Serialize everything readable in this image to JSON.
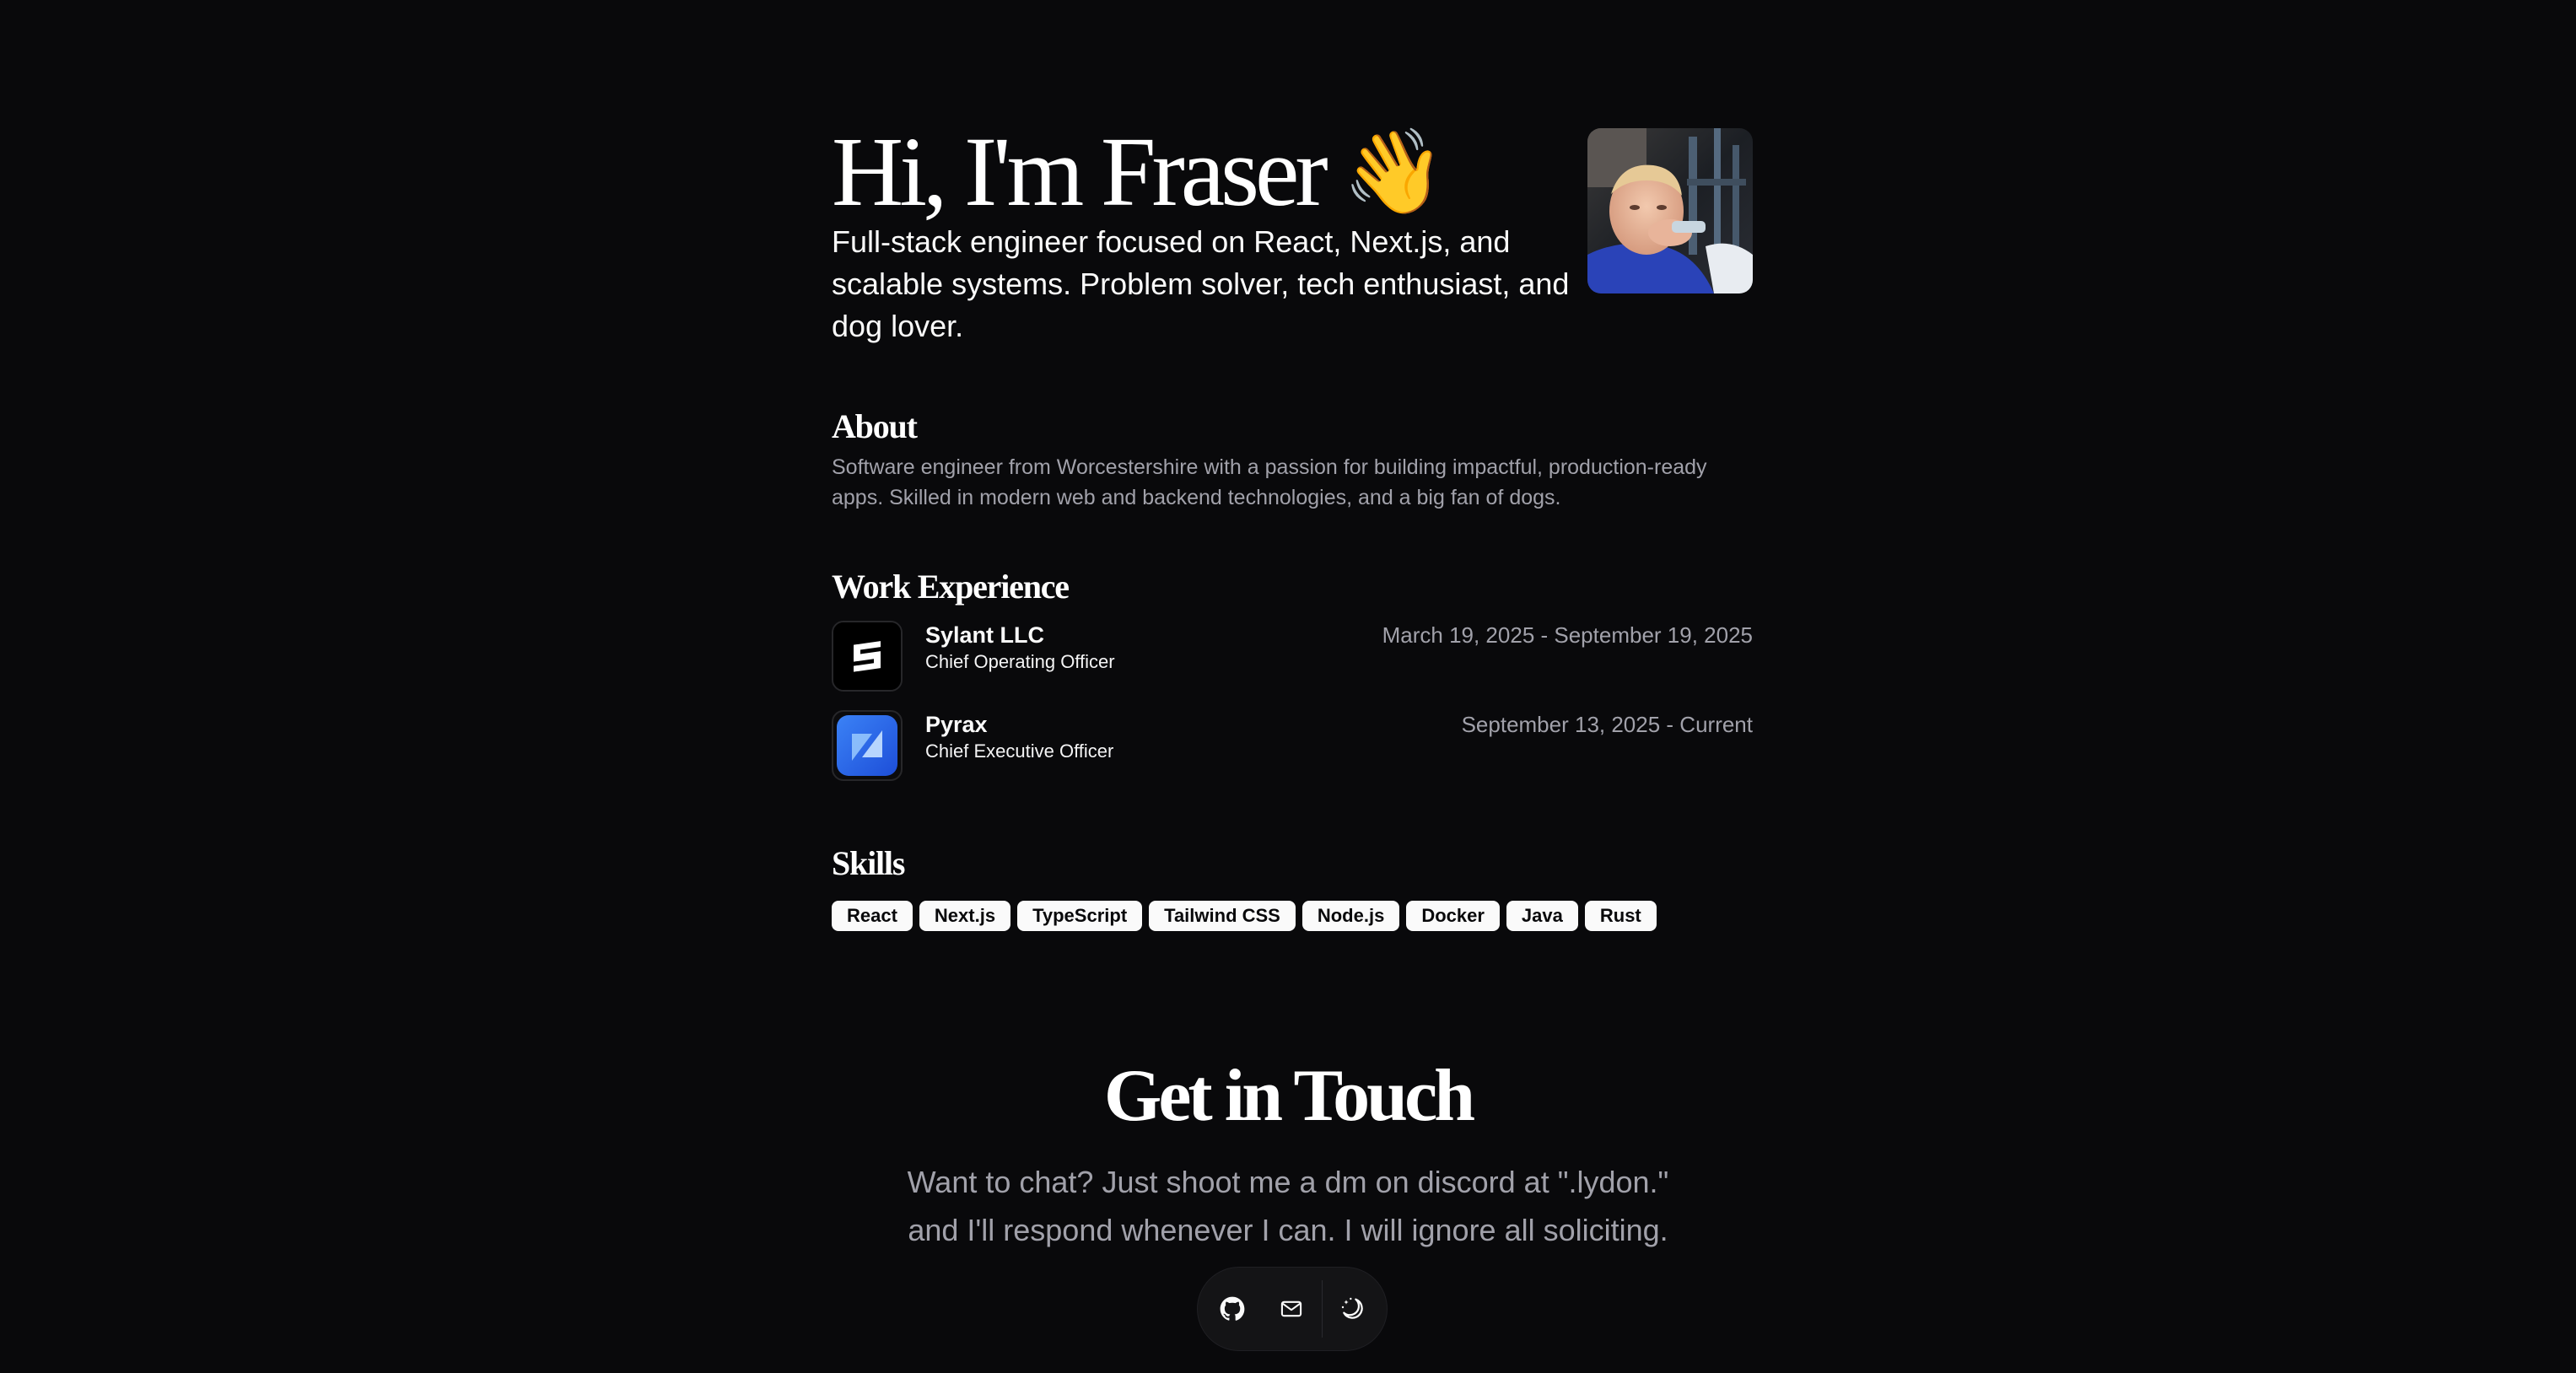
{
  "hero": {
    "title": "Hi, I'm Fraser",
    "wave_icon": "waving-hand-icon",
    "subtitle": "Full-stack engineer focused on React, Next.js, and scalable systems. Problem solver, tech enthusiast, and dog lover."
  },
  "about": {
    "heading": "About",
    "text": "Software engineer from Worcestershire with a passion for building impactful, production-ready apps. Skilled in modern web and backend technologies, and a big fan of dogs."
  },
  "work": {
    "heading": "Work Experience",
    "jobs": [
      {
        "company": "Sylant LLC",
        "role": "Chief Operating Officer",
        "dates": "March 19, 2025 - September 19, 2025",
        "logo_icon": "sylant-logo-icon"
      },
      {
        "company": "Pyrax",
        "role": "Chief Executive Officer",
        "dates": "September 13, 2025 - Current",
        "logo_icon": "pyrax-logo-icon"
      }
    ]
  },
  "skills": {
    "heading": "Skills",
    "items": [
      "React",
      "Next.js",
      "TypeScript",
      "Tailwind CSS",
      "Node.js",
      "Docker",
      "Java",
      "Rust"
    ]
  },
  "contact": {
    "heading": "Get in Touch",
    "text": "Want to chat? Just shoot me a dm on discord at \".lydon.\" and I'll respond whenever I can. I will ignore all soliciting."
  },
  "dock": {
    "items": [
      "github-icon",
      "mail-icon",
      "theme-toggle-icon"
    ]
  },
  "colors": {
    "background": "#09090b",
    "muted_text": "#a1a1aa",
    "chip_bg": "#fafafa",
    "pyrax_blue": "#2563eb"
  }
}
